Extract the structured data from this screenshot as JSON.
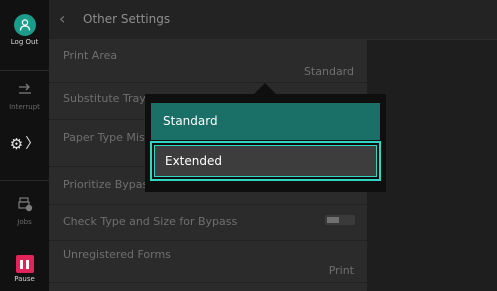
{
  "sidebar": {
    "logout_label": "Log Out",
    "interrupt_label": "Interrupt",
    "jobs_label": "Jobs",
    "pause_label": "Pause"
  },
  "header": {
    "title": "Other Settings"
  },
  "settings": {
    "print_area": {
      "label": "Print Area",
      "value": "Standard"
    },
    "substitute_tray": {
      "label": "Substitute Tray"
    },
    "paper_type_mismatch": {
      "label": "Paper Type Mis"
    },
    "prioritize_bypass": {
      "label": "Prioritize Bypas"
    },
    "check_type_size_bypass": {
      "label": "Check Type and Size for Bypass",
      "toggle_on": false
    },
    "unregistered_forms": {
      "label": "Unregistered Forms",
      "value": "Print"
    }
  },
  "popup": {
    "options": [
      "Standard",
      "Extended"
    ],
    "focused_option": "Extended"
  },
  "colors": {
    "accent": "#1c9a8a",
    "selected_option": "#1a6f66",
    "focus_ring": "#2fd6c2",
    "pause": "#e3245a"
  }
}
